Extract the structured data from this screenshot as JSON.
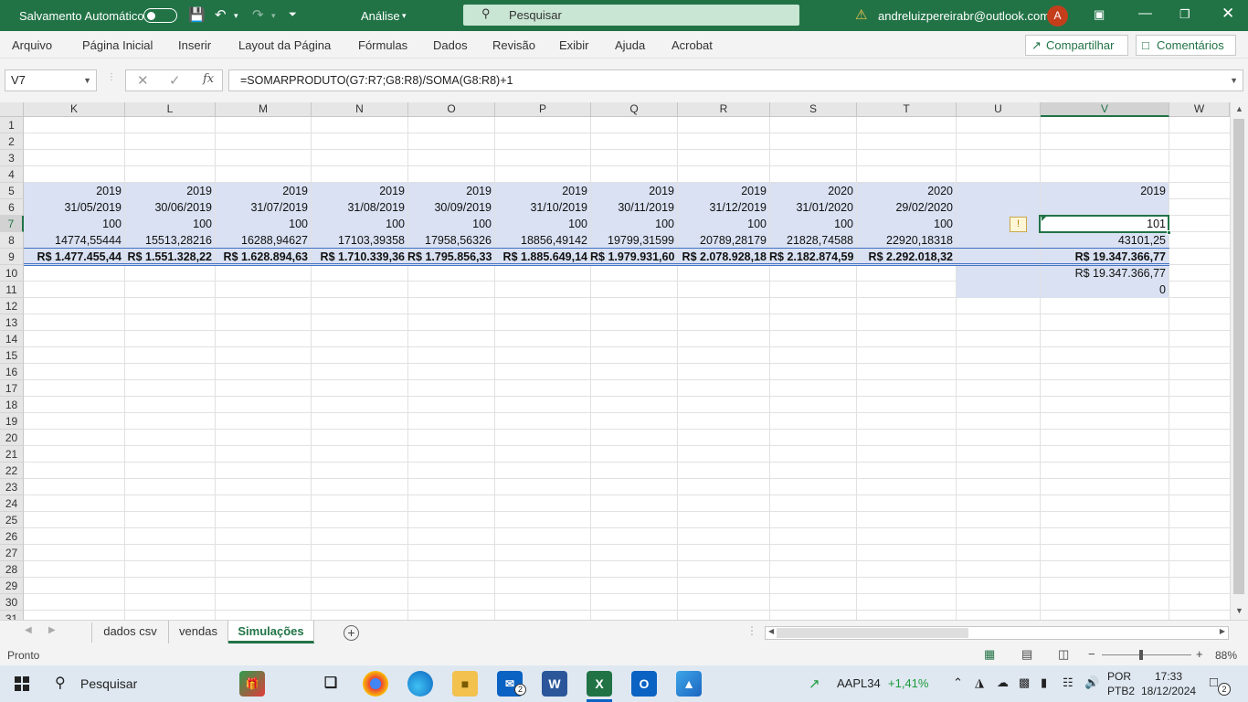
{
  "titlebar": {
    "autosave_label": "Salvamento Automático",
    "doc_title": "Análise",
    "search_placeholder": "Pesquisar",
    "account": "andreluizpereirabr@outlook.com",
    "avatar_letter": "A"
  },
  "ribbon": {
    "tabs": [
      "Arquivo",
      "Página Inicial",
      "Inserir",
      "Layout da Página",
      "Fórmulas",
      "Dados",
      "Revisão",
      "Exibir",
      "Ajuda",
      "Acrobat"
    ],
    "share_label": "Compartilhar",
    "comments_label": "Comentários"
  },
  "formula_bar": {
    "name_box": "V7",
    "fx": "fx",
    "formula": "=SOMARPRODUTO(G7:R7;G8:R8)/SOMA(G8:R8)+1"
  },
  "grid": {
    "columns": [
      "K",
      "L",
      "M",
      "N",
      "O",
      "P",
      "Q",
      "R",
      "S",
      "T",
      "U",
      "V",
      "W"
    ],
    "selected_column": "V",
    "rows": [
      "1",
      "2",
      "3",
      "4",
      "5",
      "6",
      "7",
      "8",
      "9",
      "10",
      "11",
      "12",
      "13",
      "14",
      "15",
      "16",
      "17",
      "18",
      "19",
      "20",
      "21",
      "22",
      "23",
      "24",
      "25",
      "26",
      "27",
      "28",
      "29",
      "30",
      "31"
    ],
    "selected_row": "7",
    "row5": [
      "2019",
      "2019",
      "2019",
      "2019",
      "2019",
      "2019",
      "2019",
      "2019",
      "2020",
      "2020"
    ],
    "row6": [
      "31/05/2019",
      "30/06/2019",
      "31/07/2019",
      "31/08/2019",
      "30/09/2019",
      "31/10/2019",
      "30/11/2019",
      "31/12/2019",
      "31/01/2020",
      "29/02/2020"
    ],
    "row7": [
      "100",
      "100",
      "100",
      "100",
      "100",
      "100",
      "100",
      "100",
      "100",
      "100"
    ],
    "row8": [
      "14774,55444",
      "15513,28216",
      "16288,94627",
      "17103,39358",
      "17958,56326",
      "18856,49142",
      "19799,31599",
      "20789,28179",
      "21828,74588",
      "22920,18318"
    ],
    "row9": [
      "R$ 1.477.455,44",
      "R$ 1.551.328,22",
      "R$ 1.628.894,63",
      "R$ 1.710.339,36",
      "R$ 1.795.856,33",
      "R$ 1.885.649,14",
      "R$ 1.979.931,60",
      "R$ 2.078.928,18",
      "R$ 2.182.874,59",
      "R$ 2.292.018,32"
    ],
    "v_column": {
      "v5": "2019",
      "v7": "101",
      "v8": "43101,25",
      "v9": "R$ 19.347.366,77",
      "v10": "R$ 19.347.366,77",
      "v11": "0"
    },
    "warning_icon": "!"
  },
  "sheets": {
    "tabs": [
      "dados csv",
      "vendas",
      "Simulações"
    ],
    "active": "Simulações",
    "add_icon": "+"
  },
  "status": {
    "ready": "Pronto",
    "zoom": "88%"
  },
  "taskbar": {
    "search": "Pesquisar",
    "ticker": "AAPL34",
    "ticker_change": "+1,41%",
    "lang_top": "POR",
    "lang_bottom": "PTB2",
    "time": "17:33",
    "date": "18/12/2024",
    "notif_count": "2",
    "mail_badge": "2"
  }
}
